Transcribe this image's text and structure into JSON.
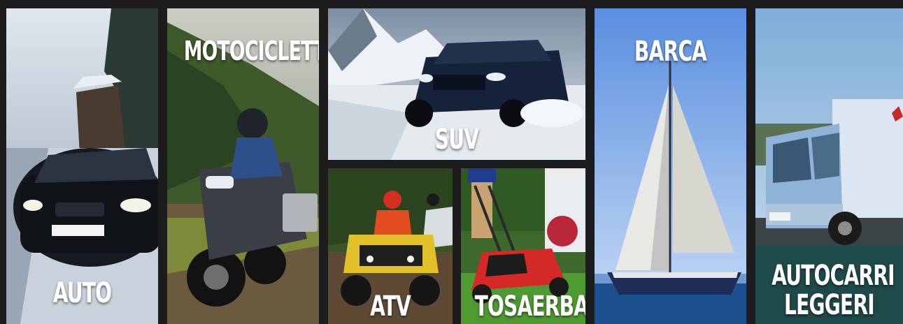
{
  "categories": [
    {
      "id": "auto",
      "label": "AUTO"
    },
    {
      "id": "moto",
      "label": "MOTOCICLETTA"
    },
    {
      "id": "suv",
      "label": "SUV"
    },
    {
      "id": "atv",
      "label": "ATV"
    },
    {
      "id": "tosaerba",
      "label": "TOSAERBA"
    },
    {
      "id": "barca",
      "label": "BARCA"
    },
    {
      "id": "truck",
      "label_line1": "AUTOCARRI",
      "label_line2": "LEGGERI"
    }
  ],
  "colors": {
    "background": "#1c1c1c",
    "label_text": "#ffffff"
  }
}
